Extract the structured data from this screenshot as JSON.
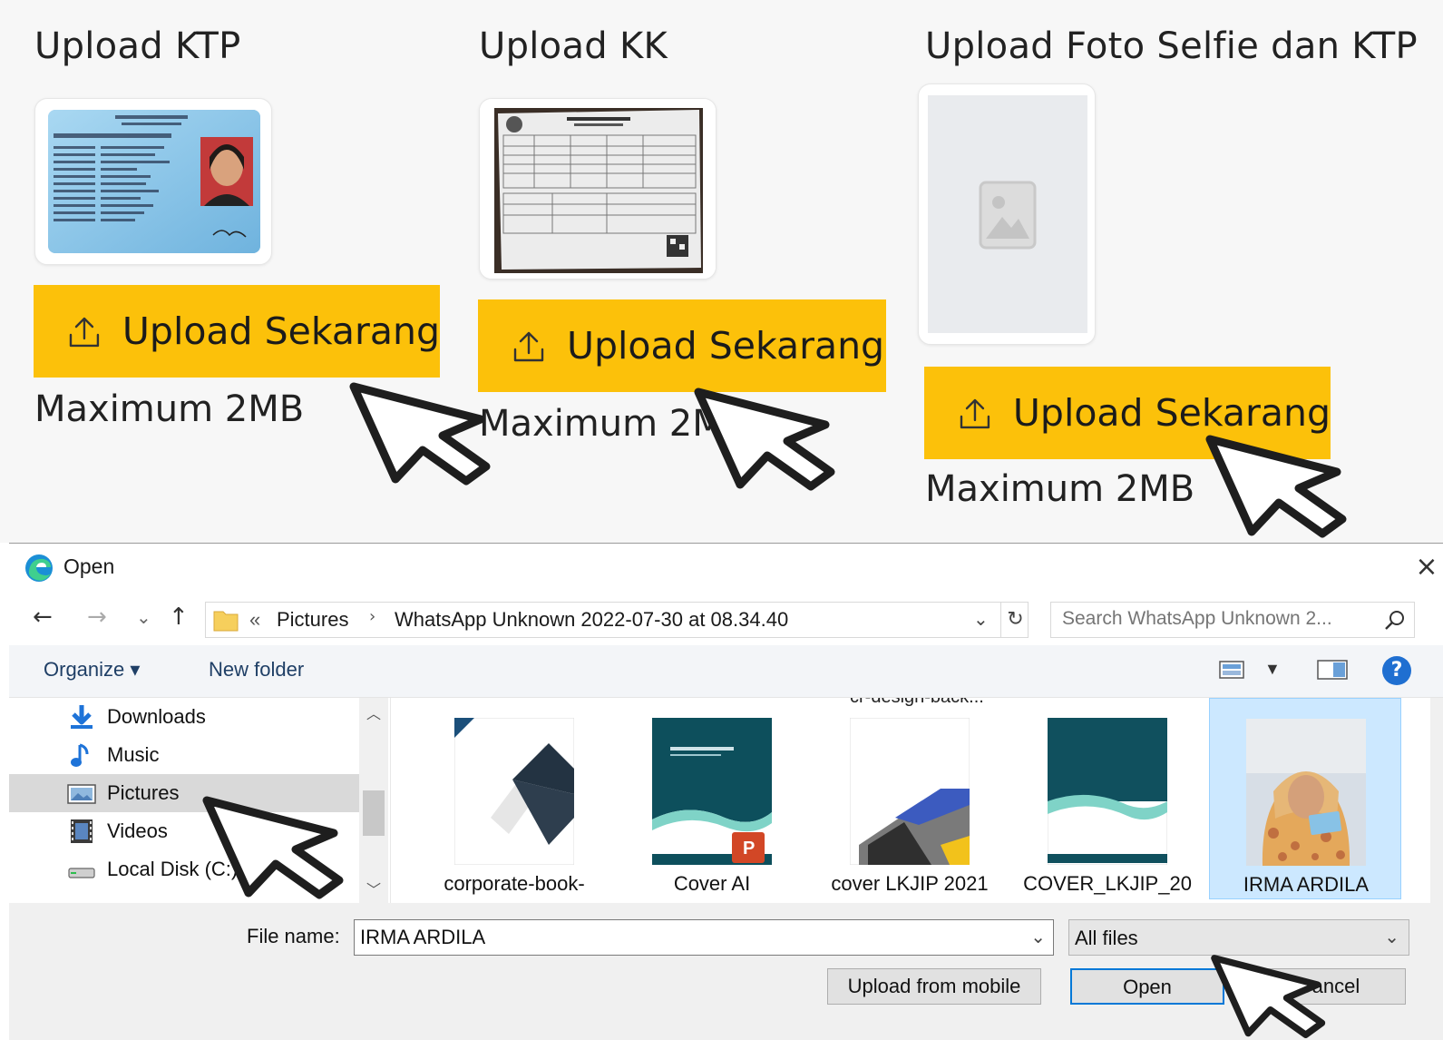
{
  "upload_panel": {
    "sections": [
      {
        "title": "Upload KTP",
        "button_label": "Upload Sekarang",
        "note": "Maximum 2MB"
      },
      {
        "title": "Upload KK",
        "button_label": "Upload Sekarang",
        "note": "Maximum 2MB"
      },
      {
        "title": "Upload Foto Selfie dan KTP",
        "button_label": "Upload Sekarang",
        "note": "Maximum 2MB"
      }
    ],
    "button_color": "#fcc10a"
  },
  "dialog": {
    "title": "Open",
    "close_glyph": "×",
    "nav": {
      "back_glyph": "←",
      "forward_glyph": "→",
      "recent_glyph": "⌄",
      "up_glyph": "↑"
    },
    "address": {
      "overflow_glyph": "«",
      "crumbs": [
        "Pictures",
        "WhatsApp Unknown 2022-07-30 at 08.34.40"
      ],
      "separator": "›"
    },
    "search": {
      "placeholder": "Search WhatsApp Unknown 2..."
    },
    "toolbar": {
      "organize": "Organize ▾",
      "new_folder": "New folder",
      "help": "?"
    },
    "nav_pane": {
      "items": [
        {
          "label": "Downloads",
          "icon": "download-icon"
        },
        {
          "label": "Music",
          "icon": "music-icon"
        },
        {
          "label": "Pictures",
          "icon": "pictures-icon",
          "selected": true
        },
        {
          "label": "Videos",
          "icon": "videos-icon"
        },
        {
          "label": "Local Disk (C:)",
          "icon": "drive-icon"
        }
      ]
    },
    "files": [
      {
        "top_caption": "",
        "label": "corporate-book-",
        "label2": "...",
        "thumb": "corporate-book-thumbnail"
      },
      {
        "top_caption": "",
        "label": "Cover AI",
        "label2": "",
        "thumb": "powerpoint-thumbnail"
      },
      {
        "top_caption": "",
        "label": "cover LKJIP 2021",
        "label2": "",
        "thumb": "lkjip-cover-thumbnail"
      },
      {
        "top_caption": "cr-design-back...",
        "label": "COVER_LKJIP_20",
        "label2": "",
        "thumb": "lkjip-cover-2-thumbnail"
      },
      {
        "top_caption": "",
        "label": "IRMA ARDILA",
        "label2": "",
        "thumb": "selfie-photo-thumbnail",
        "selected": true
      }
    ],
    "file_name_label": "File name:",
    "file_name_value": "IRMA ARDILA",
    "file_type": "All files",
    "buttons": {
      "upload_mobile": "Upload from mobile",
      "open": "Open",
      "cancel": "Cancel"
    },
    "accent": "#0078d7"
  }
}
